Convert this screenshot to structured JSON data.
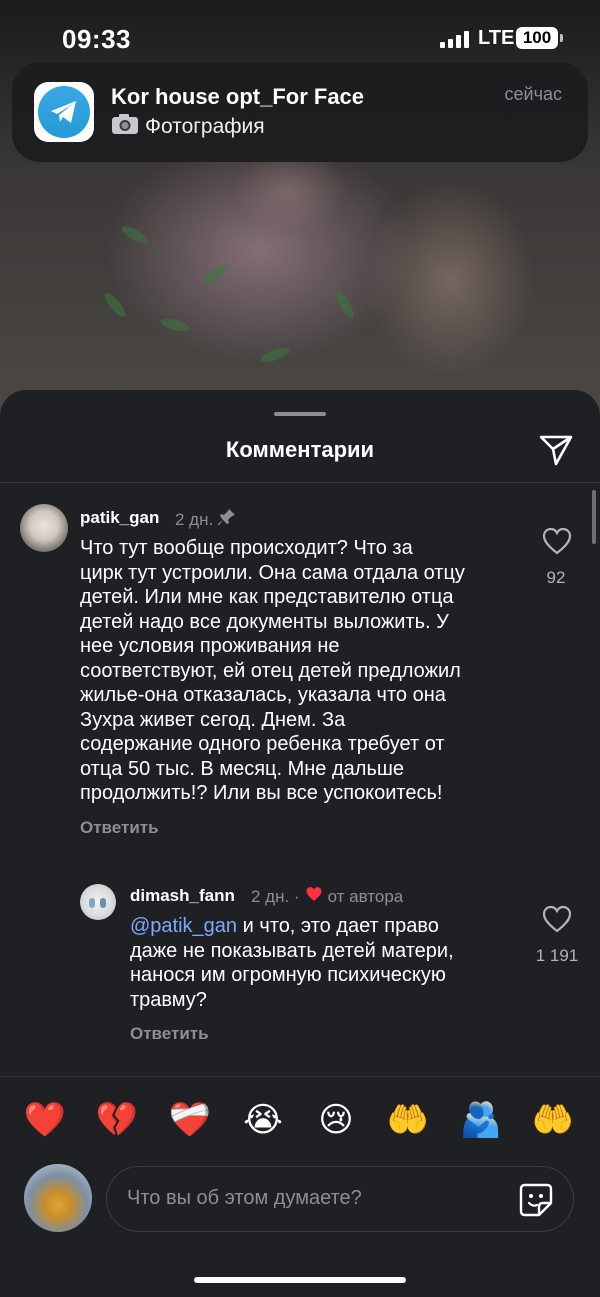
{
  "status_bar": {
    "time": "09:33",
    "network": "LTE",
    "battery": "100"
  },
  "notification": {
    "app_icon": "telegram-icon",
    "title": "Kor house opt_For Face",
    "body_icon": "camera-icon",
    "body": "Фотография",
    "time": "сейчас"
  },
  "sheet": {
    "title": "Комментарии",
    "share_icon": "send-icon"
  },
  "comments": [
    {
      "username": "patik_gan",
      "age": "2 дн.",
      "pinned": true,
      "text_lines": [
        "Что тут вообще происходит?  Что за",
        "цирк тут устроили. Она сама отдала отцу",
        "детей. Или мне как представителю отца",
        "детей надо все документы выложить.  У",
        "нее условия проживания не",
        "соответствуют, ей отец детей предложил",
        "жилье-она отказалась, указала что она",
        "Зухра живет сегод. Днем. За",
        "содержание одного ребенка требует от",
        "отца 50 тыс. В месяц.  Мне дальше",
        "продолжить!? Или вы все успокоитесь!"
      ],
      "reply_label": "Ответить",
      "likes": "92"
    },
    {
      "username": "dimash_fann",
      "age": "2 дн. ·",
      "author_badge": "от автора",
      "mention": "@patik_gan",
      "text_lines": [
        " и что, это дает право",
        "даже не показывать детей матери,",
        "нанося им огромную психическую",
        "травму?"
      ],
      "reply_label": "Ответить",
      "likes": "1 191"
    }
  ],
  "reactions": [
    "❤️",
    "💔",
    "❤️‍🩹",
    "😭",
    "😢",
    "🤲",
    "🫂",
    "🤲"
  ],
  "composer": {
    "placeholder": "Что вы об этом думаете?",
    "sticker_icon": "sticker-icon"
  },
  "colors": {
    "sheet_bg": "#1f2024",
    "mention": "#7ea8ff",
    "secondary_text": "#8e8e93",
    "heart_red": "#ff3040"
  }
}
